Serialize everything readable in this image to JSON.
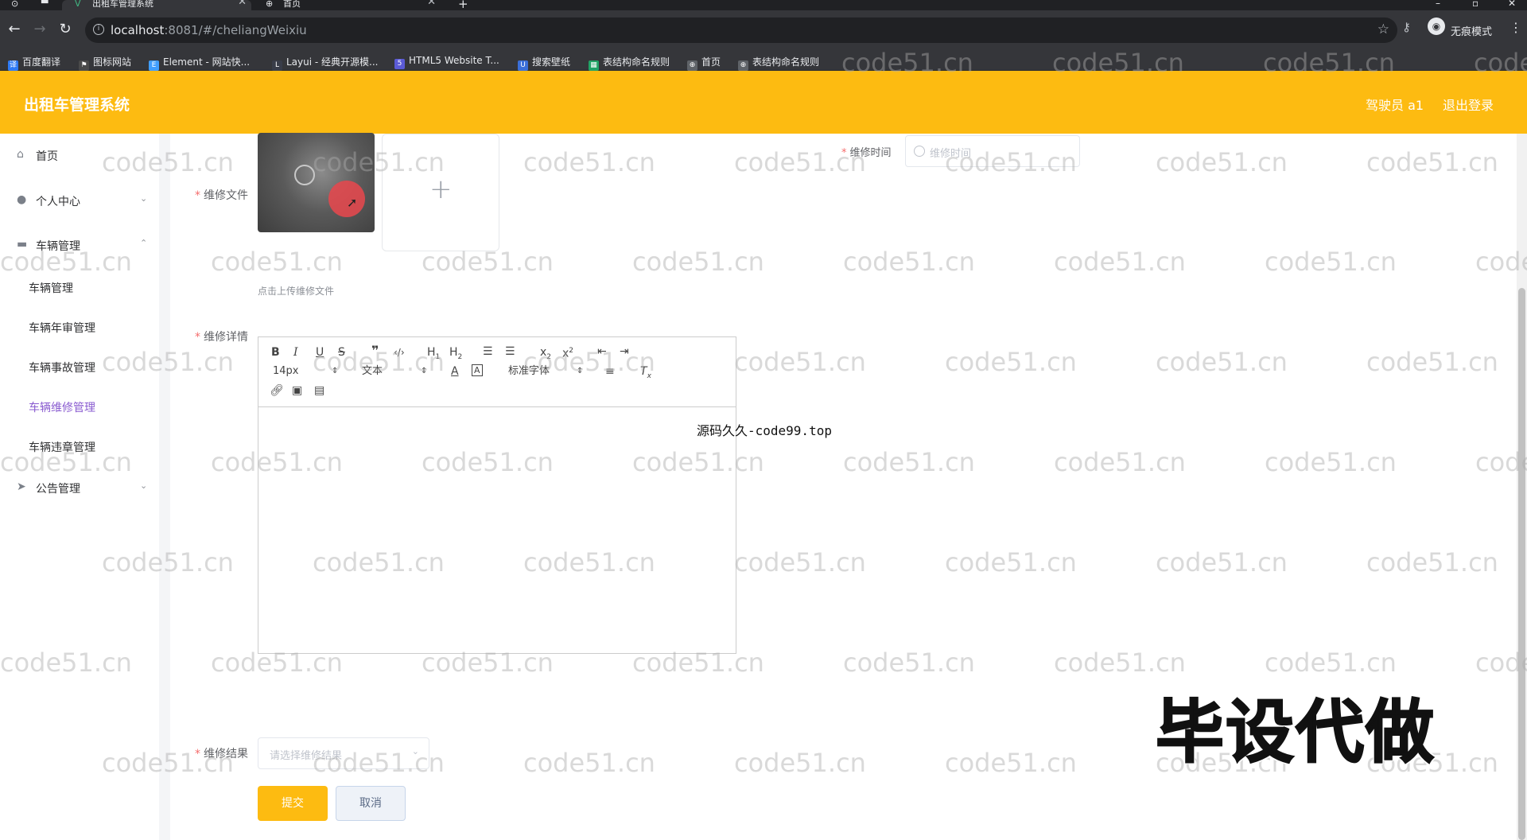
{
  "browser": {
    "tabs": [
      {
        "title": "出租车管理系统",
        "active": true
      },
      {
        "title": "首页",
        "active": false
      }
    ],
    "url_host": "localhost",
    "url_path": ":8081/#/cheliangWeixiu",
    "profile_label": "无痕模式",
    "bookmarks": [
      {
        "label": "百度翻译",
        "icon": "translate-icon"
      },
      {
        "label": "图标网站",
        "icon": "flag-icon"
      },
      {
        "label": "Element - 网站快...",
        "icon": "element-icon"
      },
      {
        "label": "Layui - 经典开源模...",
        "icon": "layui-icon"
      },
      {
        "label": "HTML5 Website T...",
        "icon": "html5-icon"
      },
      {
        "label": "搜索壁纸",
        "icon": "wallpaper-icon"
      },
      {
        "label": "表结构命名规则",
        "icon": "sheet-icon"
      },
      {
        "label": "首页",
        "icon": "globe-icon"
      },
      {
        "label": "表结构命名规则",
        "icon": "globe-icon"
      }
    ]
  },
  "header": {
    "title": "出租车管理系统",
    "user": "驾驶员 a1",
    "logout": "退出登录",
    "accent": "#fdbb11"
  },
  "sidebar": {
    "items": [
      {
        "label": "首页",
        "icon": "home-icon"
      },
      {
        "label": "个人中心",
        "icon": "user-icon"
      },
      {
        "label": "车辆管理",
        "icon": "briefcase-icon"
      },
      {
        "label": "公告管理",
        "icon": "send-icon"
      }
    ],
    "sub_items": [
      "车辆管理",
      "车辆年审管理",
      "车辆事故管理",
      "车辆维修管理",
      "车辆违章管理"
    ],
    "active_sub": "车辆维修管理",
    "active_color": "#8a5cd0"
  },
  "form": {
    "file_label": "维修文件",
    "upload_tip": "点击上传维修文件",
    "time_label": "维修时间",
    "time_placeholder": "维修时间",
    "detail_label": "维修详情",
    "result_label": "维修结果",
    "result_placeholder": "请选择维修结果",
    "submit": "提交",
    "cancel": "取消"
  },
  "editor": {
    "font_size": "14px",
    "text_type": "文本",
    "font_family": "标准字体"
  },
  "overlays": {
    "watermark": "code51.cn",
    "source_text": "源码久久-code99.top",
    "promo": "毕设代做"
  }
}
